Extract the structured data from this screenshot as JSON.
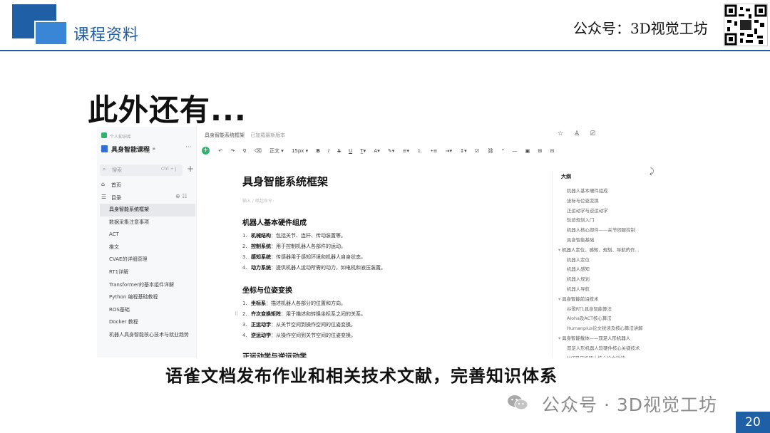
{
  "slide": {
    "section_title": "课程资料",
    "public_account": "公众号：3D视觉工坊",
    "headline": "此外还有...",
    "caption": "语雀文档发布作业和相关技术文献，完善知识体系",
    "watermark": "公众号 · 3D视觉工坊",
    "page_number": "20",
    "accent_color": "#1f5fa6"
  },
  "app": {
    "sidebar": {
      "space_label": "个人知识库",
      "book_title": "具身智能课程",
      "search_placeholder": "搜索",
      "search_shortcut": "Ctrl + J",
      "home_label": "首页",
      "toc_label": "目录",
      "items": [
        {
          "label": "具身智能系统框架",
          "active": true
        },
        {
          "label": "数据采集注意事项"
        },
        {
          "label": "ACT"
        },
        {
          "label": "推文"
        },
        {
          "label": "CVAE的详细原理"
        },
        {
          "label": "RT1详解"
        },
        {
          "label": "Transformer的基本组件详解"
        },
        {
          "label": "Python 编程基础教程"
        },
        {
          "label": "ROS基础"
        },
        {
          "label": "Docker 教程"
        },
        {
          "label": "机器人具身智能核心技术与就业趋势"
        }
      ]
    },
    "doc": {
      "breadcrumb": "具身智能系统框架",
      "breadcrumb_sub": "已加载最新版本",
      "share_label": "分享",
      "update_label": "更新",
      "toolbar": {
        "style": "正文",
        "size": "15px"
      },
      "title": "具身智能系统框架",
      "subtitle_placeholder": "输入 / 唤起命令",
      "sections": [
        {
          "heading": "机器人基本硬件组成",
          "items": [
            {
              "num": "1.",
              "term": "机械结构",
              "text": "：包括关节、连杆、传动装置等。"
            },
            {
              "num": "2.",
              "term": "控制系统",
              "text": "：用于控制机器人各部件的运动。"
            },
            {
              "num": "3.",
              "term": "感知系统",
              "text": "：传感器用于感知环境和机器人自身状态。"
            },
            {
              "num": "4.",
              "term": "动力系统",
              "text": "：提供机器人运动所需的动力，如电机和液压装置。"
            }
          ]
        },
        {
          "heading": "坐标与位姿变换",
          "items": [
            {
              "num": "1.",
              "term": "坐标系",
              "text": "：描述机器人各部分的位置和方向。"
            },
            {
              "num": "2.",
              "term": "齐次变换矩阵",
              "text": "：用于描述和转换坐标系之间的关系。"
            },
            {
              "num": "3.",
              "term": "正运动学",
              "text": "：从关节空间到操作空间的位姿变换。"
            },
            {
              "num": "4.",
              "term": "逆运动学",
              "text": "：从操作空间到关节空间的位姿变换。"
            }
          ]
        },
        {
          "heading": "正运动学与逆运动学",
          "items": []
        }
      ]
    },
    "outline": {
      "title": "大纲",
      "items": [
        {
          "label": "机器人基本硬件组成",
          "level": 2
        },
        {
          "label": "坐标与位姿变换",
          "level": 2
        },
        {
          "label": "正运动学与逆运动学",
          "level": 2
        },
        {
          "label": "轨迹规划入门",
          "level": 2
        },
        {
          "label": "机器人核心部件——关节伺服控制",
          "level": 2
        },
        {
          "label": "具身智能基础",
          "level": 2
        },
        {
          "label": "机器人定位、感知、规划、导航的作...",
          "level": 1
        },
        {
          "label": "机器人定位",
          "level": 2
        },
        {
          "label": "机器人感知",
          "level": 2
        },
        {
          "label": "机器人规划",
          "level": 2
        },
        {
          "label": "机器人导航",
          "level": 2
        },
        {
          "label": "具身智能前沿技术",
          "level": 1
        },
        {
          "label": "谷歌RT1具身智能算法",
          "level": 2
        },
        {
          "label": "Aloha及ACT核心算法",
          "level": 2
        },
        {
          "label": "Humanplus论文锐读及核心算法讲解",
          "level": 2
        },
        {
          "label": "具身智能载体——双足人形机器人",
          "level": 1
        },
        {
          "label": "双足人形机器人软硬件核心关键技术",
          "level": 2
        },
        {
          "label": "MIT双足机器人核心论文锐读",
          "level": 2
        }
      ]
    }
  }
}
